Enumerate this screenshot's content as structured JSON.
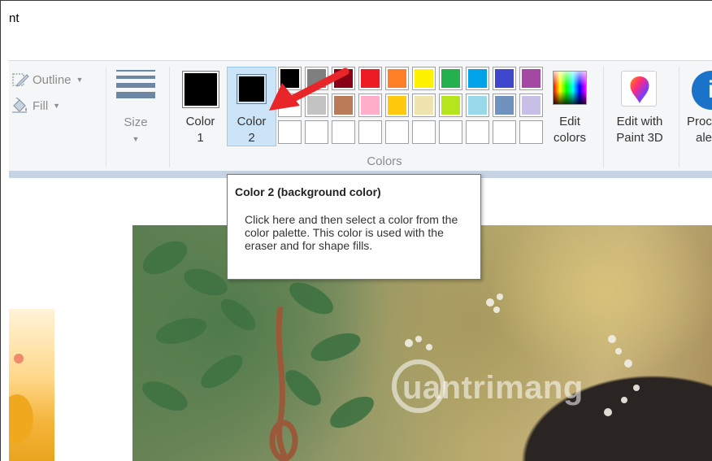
{
  "window": {
    "title": "nt"
  },
  "shapes_group": {
    "outline_label": "Outline",
    "fill_label": "Fill"
  },
  "size": {
    "label": "Size"
  },
  "colors_group": {
    "color1_label_line1": "Color",
    "color1_label_line2": "1",
    "color2_label_line1": "Color",
    "color2_label_line2": "2",
    "color1_value": "#000000",
    "color2_value": "#000000",
    "group_label": "Colors",
    "palette_row1": [
      "#000000",
      "#7f7f7f",
      "#880015",
      "#ed1c24",
      "#ff7f27",
      "#fff200",
      "#22b14c",
      "#00a2e8",
      "#3f48cc",
      "#a349a4"
    ],
    "palette_row2": [
      "#ffffff",
      "#c3c3c3",
      "#b97a57",
      "#ffaec9",
      "#ffc90e",
      "#efe4b0",
      "#b5e61d",
      "#99d9ea",
      "#7092be",
      "#c8bfe7"
    ],
    "palette_row3": [
      "",
      "",
      "",
      "",
      "",
      "",
      "",
      "",
      "",
      ""
    ],
    "edit_colors_line1": "Edit",
    "edit_colors_line2": "colors"
  },
  "paint3d": {
    "line1": "Edit with",
    "line2": "Paint 3D"
  },
  "product_alert": {
    "line1": "Proc",
    "line2": "ale"
  },
  "tooltip": {
    "title": "Color 2 (background color)",
    "body": "Click here and then select a color from the color palette. This color is used with the eraser and for shape fills."
  },
  "watermark": {
    "text": "uantrimang"
  },
  "accent_colors": {
    "selection_bg": "#cce4f7",
    "arrow": "#e8262a"
  }
}
